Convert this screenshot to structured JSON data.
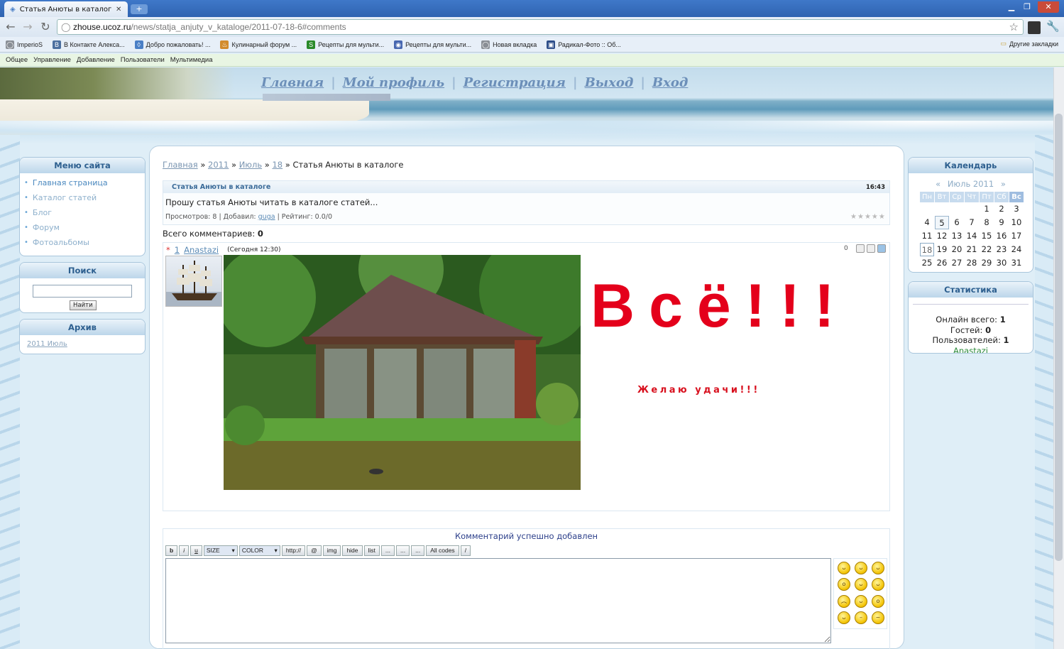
{
  "browser": {
    "tab_title": "Статья Анюты в каталоге - ",
    "new_tab": "+",
    "url_domain": "zhouse.ucoz.ru",
    "url_path": "/news/statja_anjuty_v_kataloge/2011-07-18-6#comments",
    "bookmarks": [
      {
        "label": "ImperioS",
        "icon": "globe-icon",
        "color": "#8a8f96"
      },
      {
        "label": "В Контакте  Алекса...",
        "icon": "vk-icon",
        "color": "#4b6f9f"
      },
      {
        "label": "Добро пожаловать! ...",
        "icon": "drop-icon",
        "color": "#4a7fc6"
      },
      {
        "label": "Кулинарный форум ...",
        "icon": "chef-icon",
        "color": "#d28b2c"
      },
      {
        "label": "Рецепты для мульти...",
        "icon": "s-icon",
        "color": "#2a8a2a"
      },
      {
        "label": "Рецепты для мульти...",
        "icon": "pot-icon",
        "color": "#4767b0"
      },
      {
        "label": "Новая вкладка",
        "icon": "globe-icon",
        "color": "#8a8f96"
      },
      {
        "label": "Радикал-Фото :: Об...",
        "icon": "camera-icon",
        "color": "#2d4e8a"
      }
    ],
    "other_bookmarks": "Другие закладки"
  },
  "admin_bar": [
    "Общее",
    "Управление",
    "Добавление",
    "Пользователи",
    "Мультимедиа"
  ],
  "top_nav": [
    "Главная",
    "Мой профиль",
    "Регистрация",
    "Выход",
    "Вход"
  ],
  "top_nav_sep": "|",
  "left": {
    "menu_title": "Меню сайта",
    "menu_items": [
      "Главная страница",
      "Каталог статей",
      "Блог",
      "Форум",
      "Фотоальбомы"
    ],
    "search_title": "Поиск",
    "search_button": "Найти",
    "archive_title": "Архив",
    "archive_link": "2011 Июль"
  },
  "breadcrumb": {
    "items": [
      "Главная",
      "2011",
      "Июль",
      "18"
    ],
    "sep": "»",
    "current": "Статья Анюты в каталоге"
  },
  "entry": {
    "title": "Статья Анюты в каталоге",
    "time": "16:43",
    "text": "Прошу статья Анюты читать в каталоге статей...",
    "meta_views": "Просмотров: 8 | Добавил: ",
    "meta_author": "guga",
    "meta_rating": " | Рейтинг: 0.0/0"
  },
  "comments": {
    "total_label": "Всего комментариев: ",
    "total": "0",
    "item": {
      "star": "*",
      "number": "1",
      "author": "Anastazi",
      "time": "(Сегодня 12:30)",
      "rating": "0",
      "big_text": "Всё!!!",
      "wish": "Желаю удачи!!!"
    }
  },
  "form": {
    "success": "Комментарий успешно добавлен",
    "buttons": [
      "b",
      "i",
      "u",
      "SIZE",
      "COLOR",
      "http://",
      "@",
      "img",
      "hide",
      "list",
      "...",
      "...",
      "...",
      "All codes",
      "/"
    ]
  },
  "right": {
    "calendar_title": "Календарь",
    "calendar_prev": "«",
    "calendar_month": "Июль 2011",
    "calendar_next": "»",
    "weekdays": [
      "Пн",
      "Вт",
      "Ср",
      "Чт",
      "Пт",
      "Сб",
      "Вс"
    ],
    "weeks": [
      [
        "",
        "",
        "",
        "",
        "1",
        "2",
        "3"
      ],
      [
        "4",
        "5",
        "6",
        "7",
        "8",
        "9",
        "10"
      ],
      [
        "11",
        "12",
        "13",
        "14",
        "15",
        "16",
        "17"
      ],
      [
        "18",
        "19",
        "20",
        "21",
        "22",
        "23",
        "24"
      ],
      [
        "25",
        "26",
        "27",
        "28",
        "29",
        "30",
        "31"
      ]
    ],
    "stats_title": "Статистика",
    "online_label": "Онлайн всего: ",
    "online": "1",
    "guests_label": "Гостей: ",
    "guests": "0",
    "users_label": "Пользователей: ",
    "users": "1",
    "user_link": "Anastazi"
  }
}
